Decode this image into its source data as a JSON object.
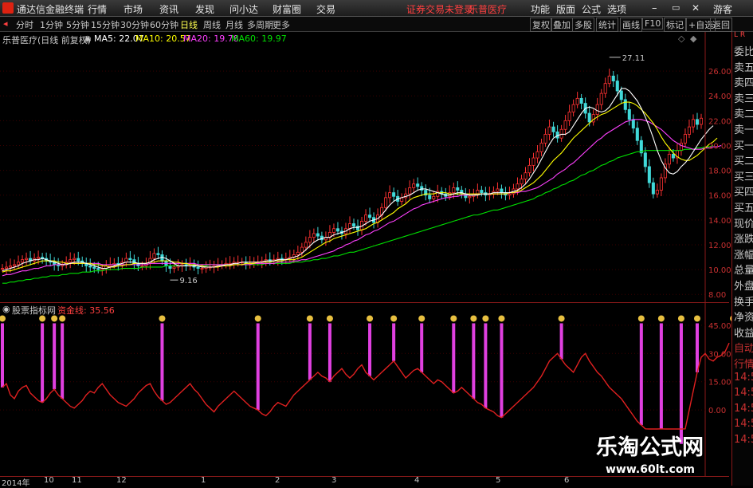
{
  "titlebar": {
    "app_title": "通达信金融终端",
    "menu": [
      "行情",
      "市场",
      "资讯",
      "发现",
      "问小达",
      "财富圈",
      "交易"
    ],
    "notice": "证券交易未登录",
    "stock_name": "乐普医疗",
    "right_menu": [
      "功能",
      "版面",
      "公式",
      "选项"
    ],
    "user": "游客"
  },
  "toolbar": {
    "periods": [
      "分时",
      "1分钟",
      "5分钟",
      "15分钟",
      "30分钟",
      "60分钟",
      "日线",
      "周线",
      "月线",
      "多周期",
      "更多"
    ],
    "active_period": "日线",
    "tools": [
      "复权",
      "叠加",
      "多股",
      "统计",
      "画线",
      "F10",
      "标记",
      "+自选",
      "返回"
    ]
  },
  "infobar": {
    "title": "乐普医疗(日线 前复权)",
    "ma5": "MA5: 22.07",
    "ma10": "MA10: 20.57",
    "ma20": "MA20: 19.78",
    "ma60": "MA60: 19.97",
    "colors": {
      "ma5": "#ffffff",
      "ma10": "#ffff00",
      "ma20": "#ff40ff",
      "ma60": "#00e000"
    }
  },
  "right_panel": [
    "委比",
    "卖五",
    "卖四",
    "卖三",
    "卖二",
    "卖一",
    "买一",
    "买二",
    "买三",
    "买四",
    "买五",
    "现价",
    "涨跌",
    "涨幅",
    "总量",
    "外盘",
    "换手",
    "净资",
    "收益",
    "自动",
    "行情",
    "14:5",
    "14:5",
    "14:5",
    "14:5",
    "14:5"
  ],
  "right_corner": "L R",
  "indicator": {
    "title": "股票指标网",
    "line_label": "资金线: 35.56",
    "axis": [
      "45.00",
      "30.00",
      "15.00",
      "0.00"
    ]
  },
  "price_axis": [
    "26.00",
    "24.00",
    "22.00",
    "20.00",
    "18.00",
    "16.00",
    "14.00",
    "12.00",
    "10.00",
    "8.00"
  ],
  "annotations": {
    "high": "27.11",
    "low": "9.16"
  },
  "x_axis": [
    "2014年",
    "10",
    "11",
    "12",
    "1",
    "2",
    "3",
    "4",
    "5",
    "6"
  ],
  "watermark": {
    "cn": "乐淘公式网",
    "url": "www.60lt.com"
  },
  "chart_data": {
    "type": "line",
    "title": "乐普医疗(日线 前复权)",
    "price_ylim": [
      7.5,
      28
    ],
    "indicator_ylim": [
      -5,
      50
    ],
    "close": [
      10.1,
      10.2,
      10.3,
      10.4,
      10.6,
      10.8,
      10.9,
      10.7,
      10.9,
      11.0,
      10.9,
      10.7,
      10.6,
      10.4,
      10.3,
      10.4,
      10.6,
      10.8,
      10.9,
      10.7,
      10.5,
      10.3,
      10.2,
      10.1,
      10.0,
      10.1,
      10.3,
      10.4,
      10.5,
      10.4,
      10.6,
      10.9,
      10.8,
      10.5,
      10.3,
      10.3,
      10.5,
      10.9,
      11.3,
      11.2,
      10.7,
      10.3,
      10.1,
      10.2,
      10.3,
      10.4,
      10.3,
      10.4,
      10.2,
      10.1,
      10.1,
      10.2,
      10.2,
      10.3,
      10.4,
      10.4,
      10.5,
      10.5,
      10.6,
      10.6,
      10.6,
      10.5,
      10.5,
      10.6,
      10.6,
      10.7,
      10.8,
      10.7,
      10.8,
      10.9,
      10.8,
      10.9,
      11.0,
      11.2,
      11.4,
      11.8,
      12.2,
      12.6,
      12.9,
      12.7,
      12.4,
      12.6,
      13.0,
      13.3,
      13.1,
      12.9,
      13.3,
      13.7,
      13.5,
      13.2,
      13.9,
      14.4,
      14.2,
      13.8,
      14.4,
      15.0,
      15.8,
      16.2,
      15.9,
      15.5,
      15.8,
      16.1,
      16.6,
      16.9,
      16.7,
      16.4,
      16.0,
      15.7,
      15.9,
      16.3,
      16.1,
      15.9,
      16.2,
      16.6,
      16.4,
      16.1,
      15.8,
      15.9,
      16.1,
      16.4,
      16.2,
      16.0,
      16.1,
      16.3,
      16.5,
      16.2,
      16.0,
      16.1,
      16.5,
      16.9,
      17.3,
      17.8,
      18.4,
      19.0,
      19.5,
      20.2,
      20.9,
      21.5,
      21.1,
      20.6,
      21.3,
      22.0,
      22.7,
      23.3,
      23.8,
      23.4,
      22.6,
      21.9,
      22.5,
      23.3,
      24.2,
      25.0,
      25.6,
      25.2,
      24.4,
      23.7,
      22.9,
      22.1,
      21.4,
      20.4,
      19.4,
      18.3,
      17.0,
      16.1,
      16.4,
      17.4,
      18.5,
      19.3,
      19.0,
      19.6,
      20.2,
      20.9,
      21.5,
      22.1,
      21.7,
      22.2
    ],
    "ma5": [
      9.9,
      10.0,
      10.1,
      10.2,
      10.3,
      10.5,
      10.6,
      10.7,
      10.8,
      10.8,
      10.9,
      10.8,
      10.7,
      10.6,
      10.5,
      10.4,
      10.4,
      10.5,
      10.6,
      10.6,
      10.6,
      10.5,
      10.4,
      10.3,
      10.2,
      10.1,
      10.1,
      10.2,
      10.3,
      10.4,
      10.5,
      10.6,
      10.6,
      10.6,
      10.5,
      10.5,
      10.5,
      10.6,
      10.8,
      10.9,
      11.0,
      10.9,
      10.7,
      10.5,
      10.3,
      10.3,
      10.3,
      10.3,
      10.3,
      10.3,
      10.2,
      10.2,
      10.2,
      10.2,
      10.3,
      10.3,
      10.4,
      10.4,
      10.5,
      10.5,
      10.6,
      10.6,
      10.6,
      10.6,
      10.6,
      10.6,
      10.7,
      10.7,
      10.7,
      10.8,
      10.8,
      10.8,
      10.9,
      11.0,
      11.1,
      11.3,
      11.6,
      11.9,
      12.2,
      12.4,
      12.5,
      12.6,
      12.6,
      12.8,
      12.9,
      13.0,
      13.1,
      13.3,
      13.4,
      13.4,
      13.5,
      13.7,
      13.9,
      14.0,
      14.1,
      14.4,
      14.8,
      15.2,
      15.5,
      15.7,
      15.8,
      15.9,
      16.0,
      16.2,
      16.4,
      16.5,
      16.5,
      16.4,
      16.3,
      16.2,
      16.1,
      16.0,
      16.0,
      16.1,
      16.2,
      16.2,
      16.1,
      16.0,
      16.0,
      16.0,
      16.1,
      16.1,
      16.1,
      16.2,
      16.2,
      16.2,
      16.2,
      16.2,
      16.3,
      16.4,
      16.6,
      16.9,
      17.3,
      17.8,
      18.3,
      18.9,
      19.5,
      20.1,
      20.6,
      20.8,
      20.9,
      20.9,
      21.1,
      21.6,
      22.1,
      22.6,
      23.0,
      23.1,
      23.0,
      22.8,
      22.7,
      22.8,
      23.1,
      23.6,
      24.1,
      24.6,
      24.6,
      24.4,
      24.0,
      23.6,
      23.0,
      22.3,
      21.5,
      20.6,
      19.6,
      18.8,
      18.2,
      17.8,
      17.7,
      17.9,
      18.3,
      18.6,
      19.0,
      19.5,
      20.0,
      20.5,
      20.9,
      21.3,
      21.6
    ],
    "ma10": [
      9.8,
      9.9,
      9.9,
      10.0,
      10.1,
      10.2,
      10.3,
      10.4,
      10.5,
      10.6,
      10.7,
      10.7,
      10.7,
      10.7,
      10.6,
      10.6,
      10.5,
      10.5,
      10.5,
      10.5,
      10.5,
      10.5,
      10.5,
      10.4,
      10.4,
      10.3,
      10.3,
      10.2,
      10.2,
      10.3,
      10.3,
      10.4,
      10.4,
      10.5,
      10.5,
      10.5,
      10.5,
      10.6,
      10.6,
      10.7,
      10.7,
      10.7,
      10.7,
      10.6,
      10.6,
      10.5,
      10.5,
      10.4,
      10.4,
      10.3,
      10.3,
      10.2,
      10.2,
      10.2,
      10.2,
      10.3,
      10.3,
      10.3,
      10.4,
      10.4,
      10.4,
      10.5,
      10.5,
      10.5,
      10.6,
      10.6,
      10.6,
      10.6,
      10.7,
      10.7,
      10.7,
      10.8,
      10.8,
      10.8,
      10.9,
      11.0,
      11.2,
      11.4,
      11.6,
      11.8,
      12.0,
      12.2,
      12.3,
      12.5,
      12.6,
      12.7,
      12.8,
      12.9,
      13.0,
      13.1,
      13.2,
      13.3,
      13.5,
      13.7,
      13.8,
      14.0,
      14.2,
      14.4,
      14.6,
      14.9,
      15.1,
      15.3,
      15.6,
      15.8,
      15.9,
      16.0,
      16.1,
      16.1,
      16.1,
      16.2,
      16.2,
      16.2,
      16.1,
      16.1,
      16.1,
      16.1,
      16.1,
      16.1,
      16.1,
      16.1,
      16.1,
      16.1,
      16.1,
      16.1,
      16.1,
      16.1,
      16.1,
      16.2,
      16.2,
      16.3,
      16.4,
      16.6,
      16.8,
      17.0,
      17.3,
      17.6,
      18.0,
      18.4,
      18.8,
      19.1,
      19.4,
      19.8,
      20.2,
      20.6,
      20.9,
      21.2,
      21.5,
      21.8,
      22.1,
      22.3,
      22.5,
      22.6,
      22.8,
      23.0,
      23.2,
      23.4,
      23.5,
      23.5,
      23.4,
      23.2,
      22.9,
      22.6,
      22.2,
      21.8,
      21.3,
      20.7,
      20.2,
      19.8,
      19.4,
      19.1,
      18.9,
      18.8,
      18.8,
      19.0,
      19.2,
      19.5,
      19.8,
      20.1,
      20.3,
      20.6
    ],
    "ma20": [
      9.5,
      9.6,
      9.6,
      9.7,
      9.8,
      9.9,
      9.9,
      10.0,
      10.1,
      10.1,
      10.2,
      10.3,
      10.3,
      10.4,
      10.4,
      10.4,
      10.5,
      10.5,
      10.5,
      10.5,
      10.5,
      10.5,
      10.5,
      10.5,
      10.5,
      10.4,
      10.4,
      10.4,
      10.4,
      10.4,
      10.4,
      10.4,
      10.4,
      10.4,
      10.4,
      10.4,
      10.4,
      10.5,
      10.5,
      10.5,
      10.5,
      10.5,
      10.5,
      10.5,
      10.5,
      10.5,
      10.5,
      10.5,
      10.5,
      10.4,
      10.4,
      10.4,
      10.4,
      10.4,
      10.4,
      10.4,
      10.4,
      10.4,
      10.4,
      10.4,
      10.4,
      10.4,
      10.4,
      10.5,
      10.5,
      10.5,
      10.5,
      10.5,
      10.5,
      10.6,
      10.6,
      10.6,
      10.6,
      10.7,
      10.7,
      10.8,
      10.8,
      10.9,
      11.0,
      11.1,
      11.2,
      11.3,
      11.4,
      11.5,
      11.7,
      11.8,
      12.0,
      12.1,
      12.3,
      12.4,
      12.6,
      12.8,
      12.9,
      13.1,
      13.2,
      13.4,
      13.6,
      13.8,
      13.9,
      14.1,
      14.3,
      14.5,
      14.7,
      14.9,
      15.0,
      15.2,
      15.3,
      15.4,
      15.5,
      15.6,
      15.7,
      15.8,
      15.8,
      15.9,
      15.9,
      16.0,
      16.0,
      16.0,
      16.0,
      16.1,
      16.1,
      16.1,
      16.1,
      16.1,
      16.1,
      16.1,
      16.1,
      16.2,
      16.2,
      16.2,
      16.3,
      16.3,
      16.4,
      16.5,
      16.6,
      16.8,
      17.0,
      17.2,
      17.4,
      17.7,
      17.9,
      18.1,
      18.4,
      18.6,
      18.9,
      19.2,
      19.5,
      19.8,
      20.1,
      20.4,
      20.6,
      20.9,
      21.1,
      21.3,
      21.5,
      21.7,
      21.9,
      22.0,
      22.1,
      22.1,
      22.1,
      22.0,
      21.9,
      21.7,
      21.5,
      21.3,
      21.0,
      20.7,
      20.4,
      20.2,
      20.0,
      19.9,
      19.8,
      19.7,
      19.7,
      19.7,
      19.8,
      19.8,
      19.9,
      19.9,
      20.0
    ],
    "ma60": [
      8.9,
      8.9,
      9.0,
      9.0,
      9.1,
      9.1,
      9.2,
      9.2,
      9.3,
      9.3,
      9.4,
      9.4,
      9.5,
      9.5,
      9.5,
      9.6,
      9.6,
      9.7,
      9.7,
      9.7,
      9.8,
      9.8,
      9.8,
      9.9,
      9.9,
      9.9,
      10.0,
      10.0,
      10.0,
      10.0,
      10.1,
      10.1,
      10.1,
      10.1,
      10.1,
      10.2,
      10.2,
      10.2,
      10.2,
      10.2,
      10.2,
      10.3,
      10.3,
      10.3,
      10.3,
      10.3,
      10.3,
      10.3,
      10.3,
      10.3,
      10.3,
      10.3,
      10.4,
      10.4,
      10.4,
      10.4,
      10.4,
      10.4,
      10.4,
      10.4,
      10.4,
      10.4,
      10.4,
      10.4,
      10.4,
      10.4,
      10.5,
      10.5,
      10.5,
      10.5,
      10.5,
      10.5,
      10.5,
      10.6,
      10.6,
      10.6,
      10.7,
      10.7,
      10.8,
      10.8,
      10.9,
      10.9,
      11.0,
      11.1,
      11.1,
      11.2,
      11.3,
      11.4,
      11.4,
      11.5,
      11.6,
      11.7,
      11.8,
      11.9,
      12.0,
      12.1,
      12.2,
      12.3,
      12.4,
      12.5,
      12.6,
      12.7,
      12.8,
      12.9,
      13.0,
      13.1,
      13.2,
      13.3,
      13.4,
      13.5,
      13.6,
      13.7,
      13.8,
      13.9,
      14.0,
      14.1,
      14.2,
      14.3,
      14.4,
      14.4,
      14.5,
      14.6,
      14.7,
      14.8,
      14.8,
      14.9,
      15.0,
      15.1,
      15.2,
      15.3,
      15.4,
      15.5,
      15.6,
      15.7,
      15.9,
      16.0,
      16.2,
      16.3,
      16.5,
      16.6,
      16.8,
      16.9,
      17.1,
      17.2,
      17.4,
      17.6,
      17.7,
      17.9,
      18.0,
      18.2,
      18.4,
      18.5,
      18.7,
      18.8,
      19.0,
      19.1,
      19.2,
      19.3,
      19.4,
      19.5,
      19.5,
      19.6,
      19.6,
      19.6,
      19.6,
      19.6,
      19.6,
      19.6,
      19.6,
      19.6,
      19.6,
      19.7,
      19.7,
      19.7,
      19.8,
      19.8,
      19.9,
      19.9,
      20.0
    ],
    "fund_line": [
      12,
      14,
      8,
      6,
      10,
      12,
      13,
      9,
      7,
      5,
      4,
      6,
      9,
      11,
      8,
      6,
      4,
      2,
      1,
      3,
      5,
      8,
      10,
      9,
      12,
      14,
      11,
      8,
      6,
      4,
      3,
      2,
      4,
      6,
      9,
      11,
      13,
      14,
      10,
      7,
      5,
      3,
      4,
      6,
      8,
      10,
      12,
      14,
      11,
      9,
      6,
      3,
      1,
      -1,
      2,
      4,
      6,
      8,
      10,
      8,
      6,
      4,
      2,
      1,
      0,
      -2,
      -3,
      -1,
      2,
      4,
      3,
      2,
      5,
      8,
      10,
      12,
      14,
      16,
      18,
      20,
      18,
      17,
      15,
      18,
      20,
      22,
      19,
      17,
      19,
      22,
      24,
      20,
      18,
      16,
      18,
      20,
      22,
      24,
      26,
      23,
      20,
      17,
      19,
      21,
      22,
      20,
      18,
      16,
      14,
      16,
      15,
      13,
      11,
      9,
      10,
      12,
      10,
      8,
      6,
      4,
      3,
      1,
      0,
      -1,
      -3,
      -4,
      -2,
      0,
      2,
      4,
      6,
      8,
      10,
      12,
      15,
      18,
      22,
      26,
      28,
      30,
      27,
      24,
      22,
      20,
      24,
      28,
      30,
      26,
      23,
      20,
      18,
      15,
      12,
      10,
      8,
      6,
      3,
      0,
      -3,
      -6,
      -8,
      -10,
      -12,
      -14,
      -12,
      -10,
      -14,
      -18,
      -20,
      -22,
      -18,
      -10,
      0,
      10,
      20,
      28,
      30,
      27,
      26,
      28,
      29,
      31,
      35.56
    ],
    "signal_index": [
      0,
      10,
      13,
      15,
      40,
      64,
      77,
      82,
      92,
      98,
      105,
      113,
      118,
      121,
      125,
      140,
      160,
      165,
      170,
      174,
      183,
      188
    ]
  }
}
